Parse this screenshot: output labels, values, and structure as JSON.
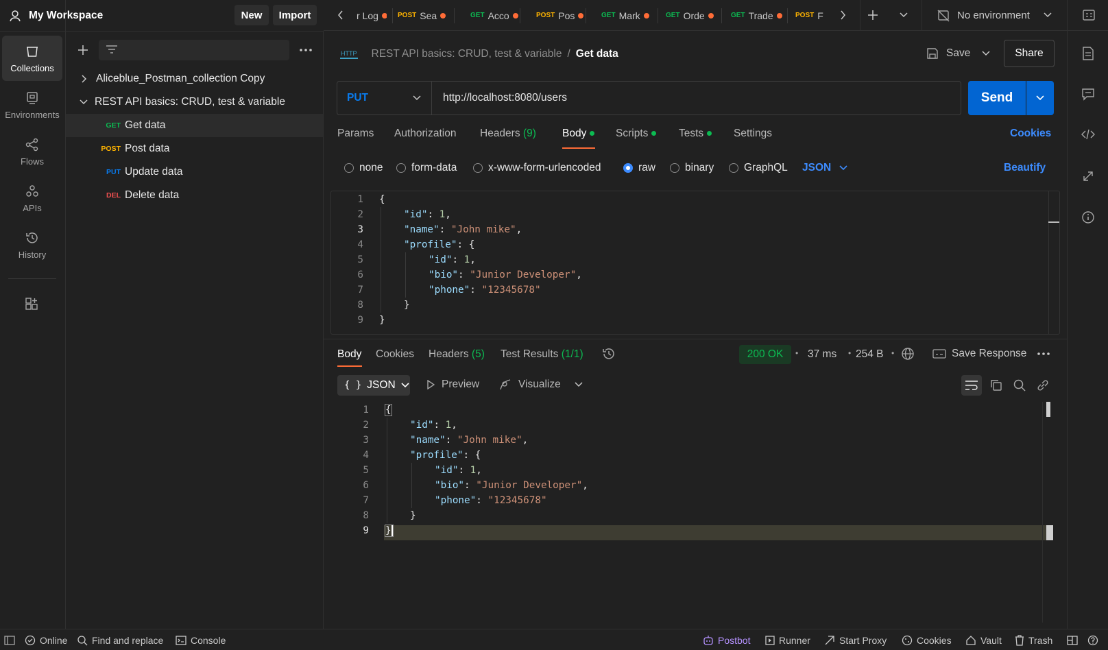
{
  "workspace": {
    "title": "My Workspace",
    "new_label": "New",
    "import_label": "Import"
  },
  "rail": [
    {
      "label": "Collections",
      "icon": "collections-icon"
    },
    {
      "label": "Environments",
      "icon": "environments-icon"
    },
    {
      "label": "Flows",
      "icon": "flows-icon"
    },
    {
      "label": "APIs",
      "icon": "apis-icon"
    },
    {
      "label": "History",
      "icon": "history-icon"
    }
  ],
  "tree": {
    "collections": [
      {
        "name": "Aliceblue_Postman_collection Copy"
      },
      {
        "name": "REST API basics: CRUD, test & variable"
      }
    ],
    "requests": [
      {
        "method": "GET",
        "name": "Get data"
      },
      {
        "method": "POST",
        "name": "Post data"
      },
      {
        "method": "PUT",
        "name": "Update data"
      },
      {
        "method": "DEL",
        "name": "Delete data"
      }
    ]
  },
  "tabs": [
    {
      "method": "",
      "name": "r Log"
    },
    {
      "method": "POST",
      "name": "Sea"
    },
    {
      "method": "GET",
      "name": "Acco"
    },
    {
      "method": "POST",
      "name": "Pos"
    },
    {
      "method": "GET",
      "name": "Mark"
    },
    {
      "method": "GET",
      "name": "Orde"
    },
    {
      "method": "GET",
      "name": "Trade"
    },
    {
      "method": "POST",
      "name": "F"
    }
  ],
  "environment": "No environment",
  "breadcrumb": {
    "parent": "REST API basics: CRUD, test & variable",
    "sep": "/",
    "current": "Get data",
    "http_badge": "HTTP"
  },
  "actions": {
    "save": "Save",
    "share": "Share"
  },
  "request": {
    "method": "PUT",
    "url": "http://localhost:8080/users",
    "send": "Send"
  },
  "request_tabs": {
    "params": "Params",
    "authorization": "Authorization",
    "headers": "Headers",
    "headers_count": "(9)",
    "body": "Body",
    "scripts": "Scripts",
    "tests": "Tests",
    "settings": "Settings",
    "cookies": "Cookies"
  },
  "body_modes": {
    "none": "none",
    "form_data": "form-data",
    "urlencoded": "x-www-form-urlencoded",
    "raw": "raw",
    "binary": "binary",
    "graphql": "GraphQL",
    "format": "JSON",
    "beautify": "Beautify"
  },
  "line_numbers": [
    "1",
    "2",
    "3",
    "4",
    "5",
    "6",
    "7",
    "8",
    "9"
  ],
  "json": {
    "key_id": "\"id\"",
    "val_id": "1",
    "key_name": "\"name\"",
    "val_name": "\"John mike\"",
    "key_profile": "\"profile\"",
    "key_bio": "\"bio\"",
    "val_bio": "\"Junior Developer\"",
    "key_phone": "\"phone\"",
    "val_phone": "\"12345678\"",
    "open_brace": "{",
    "close_brace": "}",
    "colon": ": ",
    "comma": ","
  },
  "response_tabs": {
    "body": "Body",
    "cookies": "Cookies",
    "headers": "Headers",
    "headers_count": "(5)",
    "test_results": "Test Results",
    "test_results_count": "(1/1)"
  },
  "response_meta": {
    "status": "200 OK",
    "time": "37 ms",
    "size": "254 B",
    "save_response": "Save Response",
    "sep": "•"
  },
  "response_view": {
    "format": "JSON",
    "preview": "Preview",
    "visualize": "Visualize"
  },
  "statusbar": {
    "online": "Online",
    "find_replace": "Find and replace",
    "console": "Console",
    "postbot": "Postbot",
    "runner": "Runner",
    "start_proxy": "Start Proxy",
    "cookies": "Cookies",
    "vault": "Vault",
    "trash": "Trash"
  },
  "colors": {
    "get": "#0cbb52",
    "post": "#ffb400",
    "put": "#097bed",
    "del": "#f05050",
    "accent": "#ff6c37",
    "send": "#0265d2",
    "link": "#3d8cff",
    "postbot": "#b592ff"
  }
}
